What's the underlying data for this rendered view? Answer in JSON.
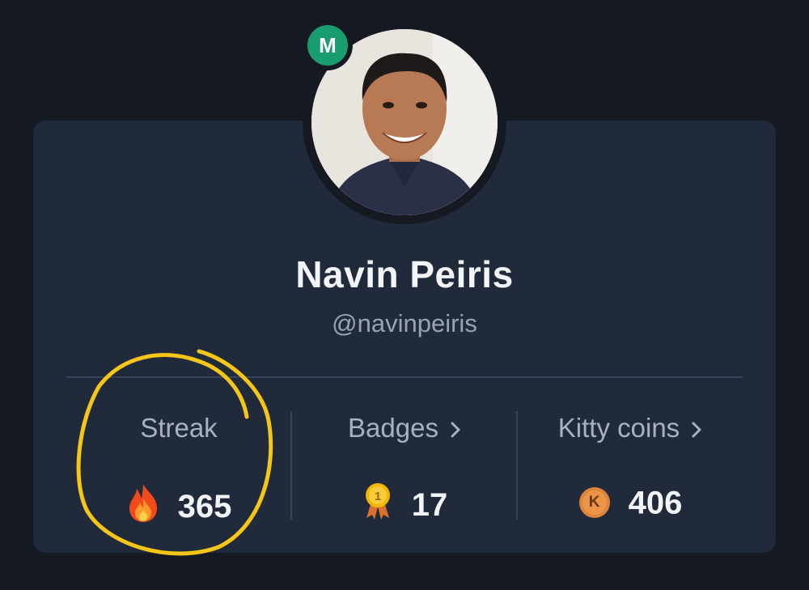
{
  "profile": {
    "name": "Navin Peiris",
    "handle": "@navinpeiris",
    "badge_letter": "M"
  },
  "stats": {
    "streak": {
      "label": "Streak",
      "value": "365",
      "icon": "fire-icon"
    },
    "badges": {
      "label": "Badges",
      "value": "17",
      "icon": "medal-icon"
    },
    "kitty_coins": {
      "label": "Kitty coins",
      "value": "406",
      "icon": "coin-icon",
      "coin_letter": "K"
    }
  },
  "colors": {
    "background": "#151922",
    "card": "#212a3b",
    "badge_green": "#1a9d6e",
    "annotation_yellow": "#f5c518"
  }
}
